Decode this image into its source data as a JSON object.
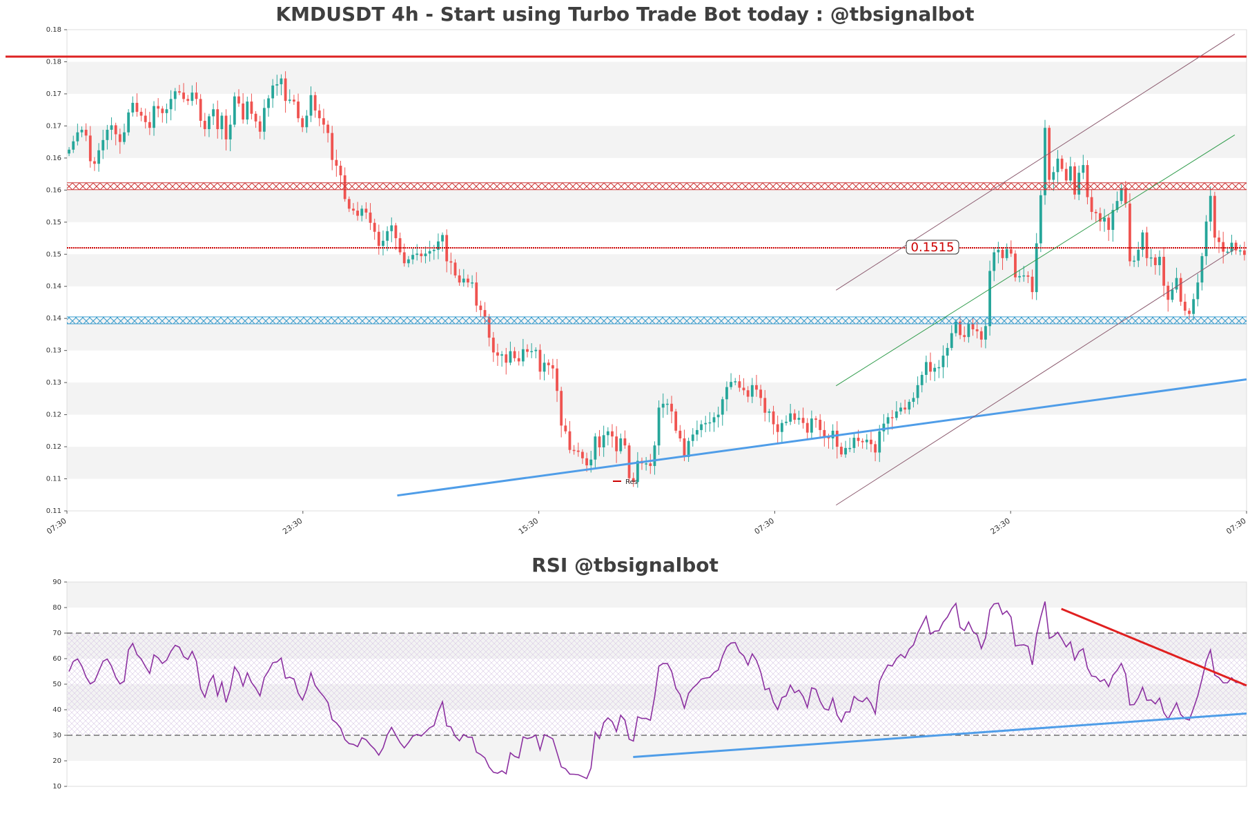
{
  "chart_data": [
    {
      "type": "candlestick",
      "title": "KMDUSDT 4h - Start using Turbo Trade Bot today : @tbsignalbot",
      "y_tick_labels": [
        "0.18",
        "0.18",
        "0.17",
        "0.17",
        "0.16",
        "0.16",
        "0.15",
        "0.15",
        "0.14",
        "0.14",
        "0.13",
        "0.13",
        "0.12",
        "0.12",
        "0.11",
        "0.11"
      ],
      "ylim": [
        0.109,
        0.184
      ],
      "x_tick_labels": [
        "07:30",
        "23:30",
        "15:30",
        "07:30",
        "23:30",
        "07:30"
      ],
      "grid": "alternating horizontal bands",
      "colors": {
        "up": "#26a69a",
        "down": "#ef5350"
      },
      "legend": {
        "label": "Res",
        "color": "#cc0000",
        "placement": "bottom-center"
      },
      "price_label": "0.1515",
      "levels": [
        {
          "kind": "resistance",
          "value": 0.1798,
          "color": "#dd2222",
          "style": "solid"
        },
        {
          "kind": "zone",
          "value": 0.1596,
          "color": "#cc3333",
          "style": "hatched"
        },
        {
          "kind": "current",
          "value": 0.15,
          "color": "#cc0000",
          "style": "dotted"
        },
        {
          "kind": "zone",
          "value": 0.1387,
          "color": "#3399cc",
          "style": "hatched"
        }
      ],
      "trendlines": [
        {
          "kind": "support",
          "color": "#4f9de8",
          "from": [
            0.28,
            0.1114
          ],
          "to": [
            1.0,
            0.1295
          ]
        },
        {
          "kind": "channel-upper",
          "color": "#8b5a6e",
          "from": [
            0.652,
            0.1434
          ],
          "to": [
            0.99,
            0.1833
          ]
        },
        {
          "kind": "channel-lower",
          "color": "#8b5a6e",
          "from": [
            0.652,
            0.1099
          ],
          "to": [
            0.99,
            0.1498
          ]
        },
        {
          "kind": "channel-mid",
          "color": "#2e9b4a",
          "from": [
            0.652,
            0.1285
          ],
          "to": [
            0.99,
            0.1676
          ]
        }
      ],
      "close": [
        0.1653,
        0.1666,
        0.168,
        0.1684,
        0.1675,
        0.1635,
        0.1631,
        0.1652,
        0.1668,
        0.1684,
        0.1691,
        0.1677,
        0.1665,
        0.168,
        0.1711,
        0.1726,
        0.1712,
        0.1706,
        0.1696,
        0.1687,
        0.1721,
        0.1717,
        0.171,
        0.1716,
        0.1732,
        0.1744,
        0.1742,
        0.1732,
        0.1729,
        0.1742,
        0.1732,
        0.1698,
        0.1685,
        0.1705,
        0.1716,
        0.1685,
        0.1706,
        0.1669,
        0.1692,
        0.1736,
        0.1725,
        0.17,
        0.1728,
        0.1709,
        0.1697,
        0.1681,
        0.1718,
        0.1733,
        0.1753,
        0.1755,
        0.1764,
        0.1729,
        0.1731,
        0.1728,
        0.1702,
        0.1688,
        0.1706,
        0.1738,
        0.1714,
        0.1702,
        0.1692,
        0.1679,
        0.1637,
        0.1628,
        0.1613,
        0.1576,
        0.1561,
        0.1558,
        0.155,
        0.1561,
        0.1555,
        0.1539,
        0.1525,
        0.1503,
        0.1511,
        0.1526,
        0.1535,
        0.1515,
        0.1493,
        0.1476,
        0.1482,
        0.1489,
        0.1491,
        0.1487,
        0.1491,
        0.1495,
        0.1497,
        0.151,
        0.152,
        0.1479,
        0.1477,
        0.1457,
        0.1446,
        0.1452,
        0.1446,
        0.1446,
        0.141,
        0.1403,
        0.1393,
        0.136,
        0.1337,
        0.1332,
        0.1334,
        0.1321,
        0.1339,
        0.1328,
        0.1323,
        0.1342,
        0.1338,
        0.1339,
        0.1341,
        0.1307,
        0.1321,
        0.1317,
        0.1312,
        0.1277,
        0.1223,
        0.1214,
        0.1185,
        0.1184,
        0.1182,
        0.1172,
        0.1161,
        0.117,
        0.1206,
        0.1189,
        0.1208,
        0.1214,
        0.1206,
        0.1183,
        0.1203,
        0.1192,
        0.1141,
        0.1135,
        0.1168,
        0.1164,
        0.1164,
        0.116,
        0.1192,
        0.1251,
        0.1257,
        0.1257,
        0.1245,
        0.1215,
        0.1203,
        0.1174,
        0.1199,
        0.1209,
        0.1216,
        0.1225,
        0.1227,
        0.1228,
        0.1236,
        0.124,
        0.1264,
        0.1283,
        0.1291,
        0.1292,
        0.1282,
        0.1278,
        0.1268,
        0.1286,
        0.1279,
        0.1266,
        0.1243,
        0.1245,
        0.1225,
        0.1213,
        0.1227,
        0.1229,
        0.1242,
        0.1232,
        0.1235,
        0.1227,
        0.1212,
        0.1234,
        0.1232,
        0.1216,
        0.1205,
        0.1203,
        0.1215,
        0.119,
        0.1178,
        0.1188,
        0.1188,
        0.1204,
        0.1199,
        0.1197,
        0.1201,
        0.1194,
        0.1181,
        0.1214,
        0.1226,
        0.1236,
        0.1235,
        0.1245,
        0.1251,
        0.1248,
        0.126,
        0.1266,
        0.1286,
        0.1302,
        0.1322,
        0.1307,
        0.1313,
        0.1314,
        0.1332,
        0.1344,
        0.1367,
        0.1385,
        0.1364,
        0.1361,
        0.1382,
        0.1373,
        0.137,
        0.1357,
        0.1378,
        0.1464,
        0.1493,
        0.1497,
        0.1484,
        0.1498,
        0.1491,
        0.1454,
        0.1456,
        0.1457,
        0.1455,
        0.1431,
        0.1507,
        0.1582,
        0.1687,
        0.1606,
        0.1618,
        0.1639,
        0.1623,
        0.1605,
        0.1627,
        0.1583,
        0.1617,
        0.1629,
        0.1579,
        0.1556,
        0.1554,
        0.1541,
        0.1547,
        0.1528,
        0.1559,
        0.1573,
        0.1593,
        0.1569,
        0.1479,
        0.148,
        0.1497,
        0.1524,
        0.1484,
        0.1485,
        0.1473,
        0.1486,
        0.1441,
        0.1419,
        0.1435,
        0.1453,
        0.1416,
        0.1402,
        0.1397,
        0.142,
        0.1446,
        0.1487,
        0.1541,
        0.1581,
        0.1516,
        0.1509,
        0.1494,
        0.1494,
        0.1508,
        0.1496,
        0.1496,
        0.1489
      ]
    },
    {
      "type": "line",
      "title": "RSI @tbsignalbot",
      "y_tick_labels": [
        "90",
        "80",
        "70",
        "60",
        "50",
        "40",
        "30",
        "20",
        "10"
      ],
      "ylim": [
        10,
        90
      ],
      "levels": [
        70,
        30
      ],
      "grid": "alternating horizontal bands",
      "color": "#8b2fa0",
      "trendlines": [
        {
          "kind": "support",
          "color": "#4f9de8",
          "from": [
            0.48,
            21.5
          ],
          "to": [
            1.0,
            38.5
          ]
        },
        {
          "kind": "resistance",
          "color": "#e02020",
          "from": [
            0.843,
            79.5
          ],
          "to": [
            1.0,
            49.5
          ]
        }
      ]
    }
  ]
}
